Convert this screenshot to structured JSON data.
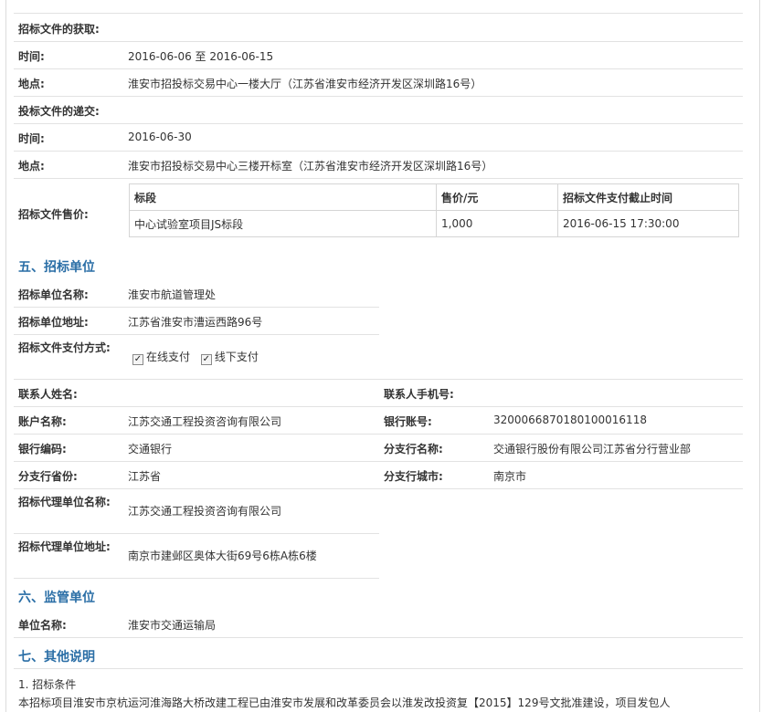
{
  "obtain": {
    "heading": "招标文件的获取:",
    "time_label": "时间:",
    "time_value": "2016-06-06 至 2016-06-15",
    "place_label": "地点:",
    "place_value": "淮安市招投标交易中心一楼大厅（江苏省淮安市经济开发区深圳路16号）"
  },
  "submit": {
    "heading": "投标文件的递交:",
    "time_label": "时间:",
    "time_value": "2016-06-30",
    "place_label": "地点:",
    "place_value": "淮安市招投标交易中心三楼开标室（江苏省淮安市经济开发区深圳路16号）"
  },
  "price": {
    "label": "招标文件售价:",
    "headers": [
      "标段",
      "售价/元",
      "招标文件支付截止时间"
    ],
    "rows": [
      [
        "中心试验室项目JS标段",
        "1,000",
        "2016-06-15 17:30:00"
      ]
    ]
  },
  "section5": {
    "title": "五、招标单位",
    "name_label": "招标单位名称:",
    "name_value": "淮安市航道管理处",
    "addr_label": "招标单位地址:",
    "addr_value": "江苏省淮安市漕运西路96号",
    "pay_label": "招标文件支付方式:",
    "pay_online": "在线支付",
    "pay_offline": "线下支付",
    "contact_label": "联系人姓名:",
    "phone_label": "联系人手机号:",
    "account_name_label": "账户名称:",
    "account_name_value": "江苏交通工程投资咨询有限公司",
    "bank_account_label": "银行账号:",
    "bank_account_value": "3200066870180100016118",
    "bank_code_label": "银行编码:",
    "bank_code_value": "交通银行",
    "branch_name_label": "分支行名称:",
    "branch_name_value": "交通银行股份有限公司江苏省分行营业部",
    "branch_province_label": "分支行省份:",
    "branch_province_value": "江苏省",
    "branch_city_label": "分支行城市:",
    "branch_city_value": "南京市",
    "agent_name_label": "招标代理单位名称:",
    "agent_name_value": "江苏交通工程投资咨询有限公司",
    "agent_addr_label": "招标代理单位地址:",
    "agent_addr_value": "南京市建邺区奥体大街69号6栋A栋6楼"
  },
  "section6": {
    "title": "六、监管单位",
    "unit_label": "单位名称:",
    "unit_value": "淮安市交通运输局"
  },
  "section7": {
    "title": "七、其他说明",
    "line1": "1. 招标条件",
    "line2": "本招标项目淮安市京杭运河淮海路大桥改建工程已由淮安市发展和改革委员会以淮发改投资复【2015】129号文批准建设，项目发包人"
  }
}
